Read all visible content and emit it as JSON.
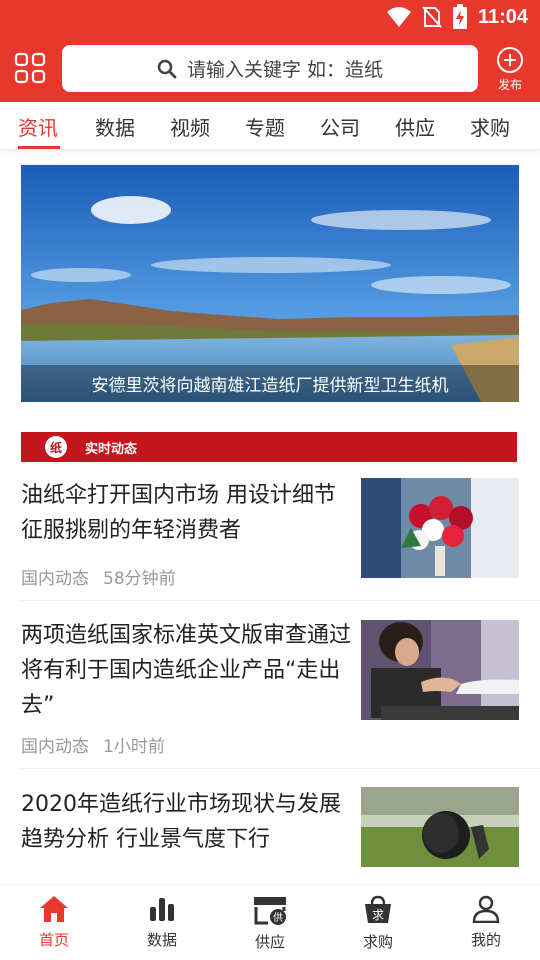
{
  "status_bar": {
    "time": "11:04",
    "icons": [
      "wifi-icon",
      "no-sim-icon",
      "battery-charging-icon"
    ]
  },
  "header": {
    "menu_icon": "grid-icon",
    "search_placeholder": "请输入关键字 如：造纸",
    "publish_label": "发布"
  },
  "tabs": [
    {
      "label": "资讯",
      "active": true
    },
    {
      "label": "数据"
    },
    {
      "label": "视频"
    },
    {
      "label": "专题"
    },
    {
      "label": "公司"
    },
    {
      "label": "供应"
    },
    {
      "label": "求购"
    }
  ],
  "banner": {
    "caption": "安德里茨将向越南雄江造纸厂提供新型卫生纸机"
  },
  "section": {
    "logo_text": "纸",
    "title": "实时动态"
  },
  "news": [
    {
      "title_line1": "油纸伞打开国内市场 用设计细节",
      "title_line2": "征服挑剔的年轻消费者",
      "title_line3": "",
      "category": "国内动态",
      "time": "58分钟前"
    },
    {
      "title_line1": "两项造纸国家标准英文版审查通过",
      "title_line2": "将有利于国内造纸企业产品“走出",
      "title_line3": "去”",
      "category": "国内动态",
      "time": "1小时前"
    },
    {
      "title_line1": "2020年造纸行业市场现状与发展",
      "title_line2": "趋势分析 行业景气度下行",
      "title_line3": ""
    }
  ],
  "bottom_nav": [
    {
      "label": "首页",
      "icon": "home-icon",
      "active": true
    },
    {
      "label": "数据",
      "icon": "bar-chart-icon"
    },
    {
      "label": "供应",
      "icon": "store-icon",
      "badge": "供"
    },
    {
      "label": "求购",
      "icon": "shopping-bag-icon",
      "badge": "求"
    },
    {
      "label": "我的",
      "icon": "user-icon"
    }
  ],
  "colors": {
    "brand": "#e8382d",
    "section_bar": "#c3151b"
  }
}
